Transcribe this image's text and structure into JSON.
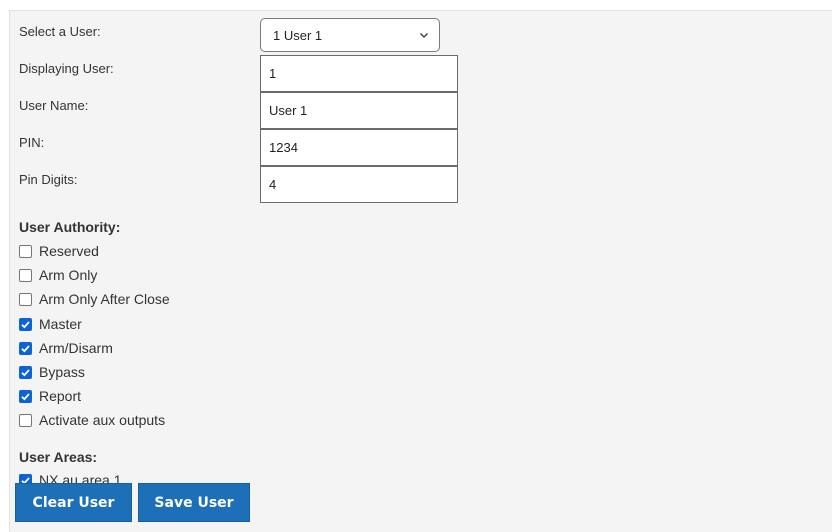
{
  "form": {
    "select_user_label": "Select a User:",
    "selected_user": "1 User 1",
    "displaying_user_label": "Displaying User:",
    "displaying_user_value": "1",
    "user_name_label": "User Name:",
    "user_name_value": "User 1",
    "pin_label": "PIN:",
    "pin_value": "1234",
    "pin_digits_label": "Pin Digits:",
    "pin_digits_value": "4"
  },
  "authority": {
    "title": "User Authority:",
    "items": [
      {
        "label": "Reserved",
        "checked": false
      },
      {
        "label": "Arm Only",
        "checked": false
      },
      {
        "label": "Arm Only After Close",
        "checked": false
      },
      {
        "label": "Master",
        "checked": true
      },
      {
        "label": "Arm/Disarm",
        "checked": true
      },
      {
        "label": "Bypass",
        "checked": true
      },
      {
        "label": "Report",
        "checked": true
      },
      {
        "label": "Activate aux outputs",
        "checked": false
      }
    ]
  },
  "areas": {
    "title": "User Areas:",
    "items": [
      {
        "label": "NX au area 1",
        "checked": true
      }
    ]
  },
  "buttons": {
    "clear": "Clear User",
    "save": "Save User"
  },
  "colors": {
    "checkbox_checked": "#0b63d6",
    "button_bg": "#1d6fb8",
    "panel_bg": "#f4f4f4"
  }
}
